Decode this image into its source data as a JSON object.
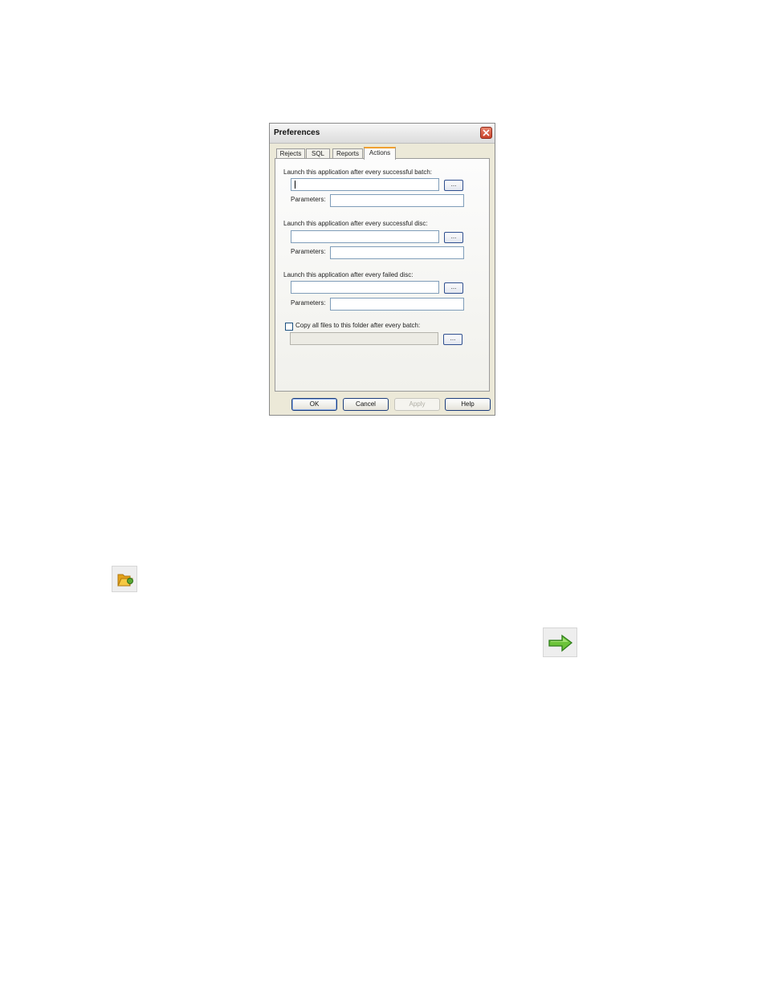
{
  "dialog": {
    "title": "Preferences",
    "tabs": [
      {
        "label": "Rejects",
        "active": false
      },
      {
        "label": "SQL",
        "active": false
      },
      {
        "label": "Reports",
        "active": false
      },
      {
        "label": "Actions",
        "active": true
      }
    ],
    "sections": [
      {
        "label": "Launch this application after every successful batch:",
        "app_value": "",
        "params_label": "Parameters:",
        "params_value": ""
      },
      {
        "label": "Launch this application after every successful disc:",
        "app_value": "",
        "params_label": "Parameters:",
        "params_value": ""
      },
      {
        "label": "Launch this application after every failed disc:",
        "app_value": "",
        "params_label": "Parameters:",
        "params_value": ""
      }
    ],
    "copy_files": {
      "label": "Copy all files to this folder after every batch:",
      "checked": false,
      "path_value": ""
    },
    "browse_label": "...",
    "buttons": {
      "ok": "OK",
      "cancel": "Cancel",
      "apply": "Apply",
      "help": "Help"
    }
  },
  "icons": {
    "folder_icon": "folder-open-icon",
    "arrow_icon": "green-arrow-right-icon"
  },
  "colors": {
    "active_tab_accent": "#f0a030",
    "close_button": "#c9432a",
    "button_border": "#1c3d7a"
  }
}
